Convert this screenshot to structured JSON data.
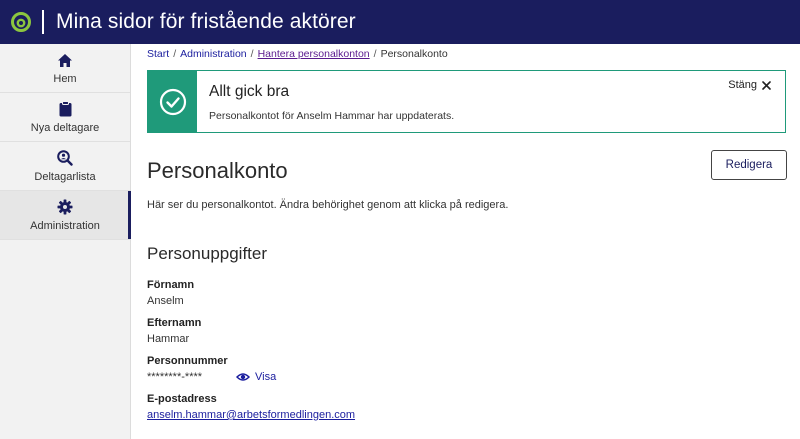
{
  "header": {
    "title": "Mina sidor för fristående aktörer",
    "logo_icon": "af-logo-icon",
    "accent": "#1a1d5e"
  },
  "sidebar": {
    "items": [
      {
        "label": "Hem",
        "icon": "home-icon"
      },
      {
        "label": "Nya deltagare",
        "icon": "clipboard-icon"
      },
      {
        "label": "Deltagarlista",
        "icon": "search-user-icon"
      },
      {
        "label": "Administration",
        "icon": "gear-icon",
        "active": true
      }
    ]
  },
  "breadcrumb": {
    "items": [
      "Start",
      "Administration",
      "Hantera personalkonton",
      "Personalkonto"
    ],
    "separator": "/"
  },
  "alert": {
    "title": "Allt gick bra",
    "text": "Personalkontot för Anselm Hammar har uppdaterats.",
    "close_label": "Stäng",
    "color": "#1f9a7a"
  },
  "page": {
    "title": "Personalkonto",
    "edit_label": "Redigera",
    "intro": "Här ser du personalkontot. Ändra behörighet genom att klicka på redigera."
  },
  "personal": {
    "section_title": "Personuppgifter",
    "first_name_label": "Förnamn",
    "first_name": "Anselm",
    "last_name_label": "Efternamn",
    "last_name": "Hammar",
    "ssn_label": "Personnummer",
    "ssn": "********-****",
    "show_label": "Visa",
    "email_label": "E-postadress",
    "email": "anselm.hammar@arbetsformedlingen.com"
  }
}
